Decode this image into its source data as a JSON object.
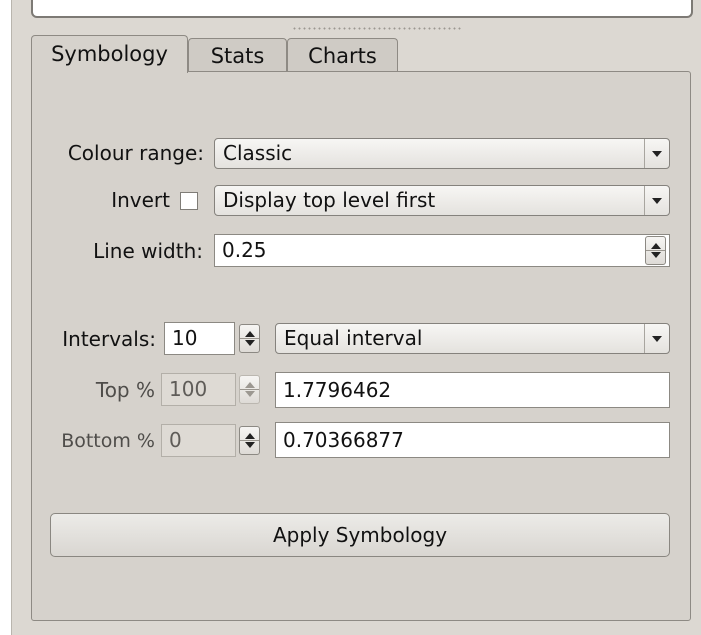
{
  "tabs": [
    {
      "label": "Symbology",
      "active": true
    },
    {
      "label": "Stats",
      "active": false
    },
    {
      "label": "Charts",
      "active": false
    }
  ],
  "symbology": {
    "colour_range_label": "Colour range:",
    "colour_range_value": "Classic",
    "invert_label": "Invert",
    "invert_checked": false,
    "display_order_value": "Display top level first",
    "line_width_label": "Line width:",
    "line_width_value": "0.25",
    "intervals_label": "Intervals:",
    "intervals_value": "10",
    "interval_method_value": "Equal interval",
    "top_label": "Top %",
    "top_percent_value": "100",
    "top_value": "1.7796462",
    "bottom_label": "Bottom %",
    "bottom_percent_value": "0",
    "bottom_value": "0.70366877",
    "apply_button_label": "Apply Symbology"
  }
}
